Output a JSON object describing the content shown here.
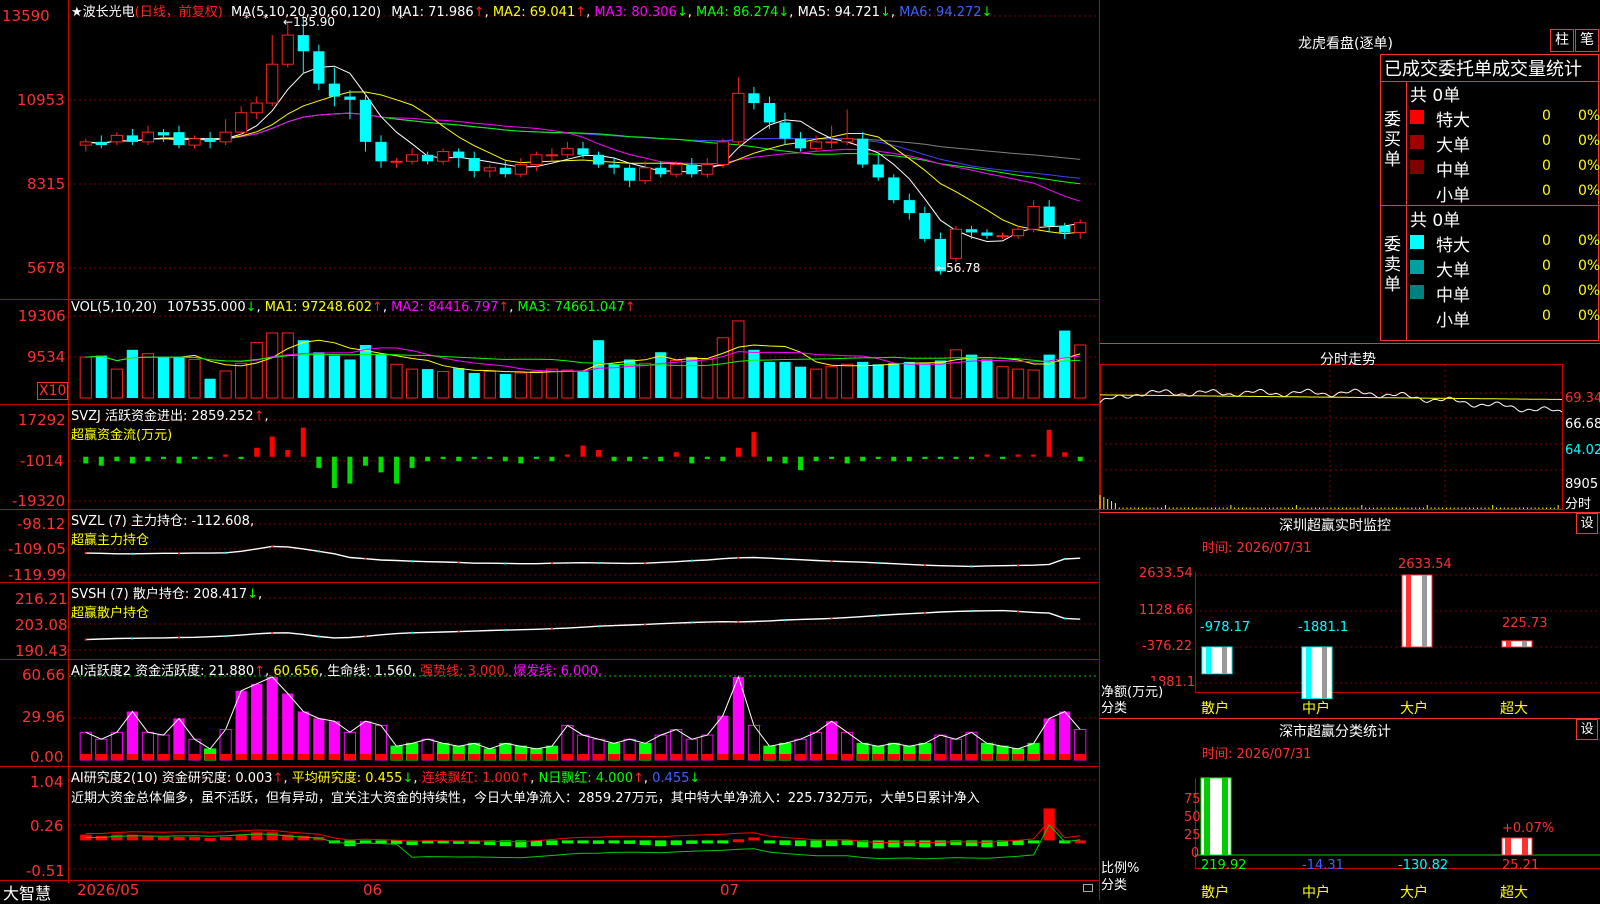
{
  "colors": {
    "up": "#ff2020",
    "down": "#00ffff",
    "red": "#ff0000",
    "ma1": "#ffffff",
    "ma2": "#ffff00",
    "ma3": "#ff00ff",
    "ma4": "#00ff00",
    "ma5": "#4040ff",
    "ma6": "#808080",
    "bg": "#000000",
    "grid": "#800000",
    "border": "#ff0000",
    "magenta": "#ff00ff",
    "green": "#00ff00",
    "cyan": "#00ffff",
    "yellow": "#ffff00"
  },
  "header": {
    "stock_name": "★波长光电",
    "period": "(日线，前复权)",
    "ma_label": "MA(5,10,20,30,60,120)",
    "ma1": "MA1: 71.986",
    "ma2": "MA2: 69.041",
    "ma3": "MA3: 80.306",
    "ma4": "MA4: 86.274",
    "ma5": "MA5: 94.721",
    "ma6": "MA6: 94.272",
    "arrow_up": "↑",
    "arrow_down": "↓"
  },
  "price_axis": {
    "ticks": [
      "13590",
      "10953",
      "8315",
      "5678"
    ],
    "high_label": "135.90",
    "low_label": "56.78"
  },
  "vol": {
    "label": "VOL(5,10,20)",
    "value": "107535.000",
    "arrow": "↓",
    "ma1": "MA1: 97248.602",
    "ma2": "MA2: 84416.797",
    "ma3": "MA3: 74661.047",
    "ticks": [
      "19306",
      "9534"
    ],
    "unit": "X10"
  },
  "svzj": {
    "label": "SVZJ  活跃资金进出: 2859.252",
    "subtitle": "超赢资金流(万元)",
    "ticks": [
      "17292",
      "-1014",
      "-19320"
    ]
  },
  "svzl": {
    "label": "SVZL (7) 主力持仓: -112.608",
    "subtitle": "超赢主力持仓",
    "ticks": [
      "-98.12",
      "-109.05",
      "-119.99"
    ]
  },
  "svsh": {
    "label": "SVSH (7) 散户持仓: 208.417",
    "subtitle": "超赢散户持仓",
    "ticks": [
      "216.21",
      "203.08",
      "190.43"
    ]
  },
  "ai_active": {
    "label": "AI活跃度2 资金活跃度: 21.880",
    "v2": "60.656",
    "life": "生命线: 1.560,",
    "strong": "强势线: 3.000,",
    "burst": "爆发线: 6.000,",
    "ticks": [
      "60.66",
      "29.96",
      "0.00"
    ]
  },
  "ai_research": {
    "label": "AI研究度2(10) 资金研究度: 0.003",
    "avg": "平均研究度: 0.455",
    "red_days": "连续飘红: 1.000",
    "n_red": "N日飘红: 4.000",
    "last": "0.455",
    "ticks": [
      "1.04",
      "0.26",
      "-0.51"
    ],
    "comment": "近期大资金总体偏多，虽不活跃，但有异动，宜关注大资金的持续性，今日大单净流入：2859.27万元，其中特大单净流入：225.732万元，大单5日累计净入"
  },
  "bottom_axis": {
    "logo": "大智慧",
    "dates": [
      "2026/05",
      "06",
      "07"
    ]
  },
  "lhb": {
    "title": "龙虎看盘(逐单)",
    "btn_bar": "柱",
    "btn_pen": "笔",
    "subtitle": "已成交委托单成交量统计",
    "buy_label": "委买单",
    "sell_label": "委卖单",
    "buy_total": "共 0单",
    "sell_total": "共 0单",
    "buy_rows": [
      {
        "name": "特大",
        "count": "0",
        "pct": "0%"
      },
      {
        "name": "大单",
        "count": "0",
        "pct": "0%"
      },
      {
        "name": "中单",
        "count": "0",
        "pct": "0%"
      },
      {
        "name": "小单",
        "count": "0",
        "pct": "0%"
      }
    ],
    "sell_rows": [
      {
        "name": "特大",
        "count": "0",
        "pct": "0%"
      },
      {
        "name": "大单",
        "count": "0",
        "pct": "0%"
      },
      {
        "name": "中单",
        "count": "0",
        "pct": "0%"
      },
      {
        "name": "小单",
        "count": "0",
        "pct": "0%"
      }
    ]
  },
  "intraday": {
    "title": "分时走势",
    "ticks": [
      "69.34",
      "66.68",
      "64.02"
    ],
    "vol_tick": "8905",
    "unit": "分时"
  },
  "sz_monitor": {
    "title": "深圳超赢实时监控",
    "btn": "设",
    "time": "时间: 2026/07/31",
    "ticks": [
      "2633.54",
      "1128.66",
      "-376.22",
      "-1881.1"
    ],
    "bars": [
      {
        "label": "散户",
        "value": -978.17,
        "text": "-978.17"
      },
      {
        "label": "中户",
        "value": -1881.1,
        "text": "-1881.1"
      },
      {
        "label": "大户",
        "value": 2633.54,
        "text": "2633.54"
      },
      {
        "label": "超大",
        "value": 225.73,
        "text": "225.73"
      }
    ],
    "ylabel": "净额(万元)",
    "xlabel": "分类"
  },
  "sz_classify": {
    "title": "深市超赢分类统计",
    "btn": "设",
    "time": "时间: 2026/07/31",
    "ticks": [
      "75",
      "50",
      "25",
      "0"
    ],
    "bars": [
      {
        "label": "散户",
        "text": "219.92"
      },
      {
        "label": "中户",
        "text": "-14.31"
      },
      {
        "label": "大户",
        "text": "-130.82"
      },
      {
        "label": "超大",
        "text": "25.21",
        "top_text": "+0.07%"
      }
    ],
    "ylabel": "比例%",
    "xlabel": "分类"
  },
  "chart_data": [
    {
      "type": "candlestick",
      "title": "波长光电 日线",
      "ylim": [
        56.78,
        135.9
      ],
      "candles": [
        [
          96,
          97,
          94,
          98
        ],
        [
          97,
          96,
          95,
          99
        ],
        [
          97,
          99,
          96,
          100
        ],
        [
          99,
          97,
          96,
          101
        ],
        [
          97,
          100,
          96,
          102
        ],
        [
          100,
          99,
          97,
          101
        ],
        [
          100,
          96,
          95,
          102
        ],
        [
          96,
          98,
          95,
          99
        ],
        [
          98,
          97,
          95,
          100
        ],
        [
          97,
          100,
          96,
          104
        ],
        [
          100,
          106,
          99,
          108
        ],
        [
          106,
          109,
          104,
          111
        ],
        [
          109,
          121,
          108,
          130
        ],
        [
          121,
          130,
          120,
          134
        ],
        [
          130,
          125,
          118,
          136
        ],
        [
          125,
          115,
          113,
          127
        ],
        [
          115,
          111,
          108,
          120
        ],
        [
          111,
          110,
          104,
          113
        ],
        [
          110,
          97,
          94,
          112
        ],
        [
          97,
          91,
          89,
          99
        ],
        [
          91,
          91,
          89,
          92
        ],
        [
          91,
          93,
          90,
          95
        ],
        [
          93,
          91,
          90,
          94
        ],
        [
          91,
          94,
          90,
          95
        ],
        [
          94,
          92,
          89,
          95
        ],
        [
          92,
          88,
          86,
          94
        ],
        [
          88,
          89,
          86,
          90
        ],
        [
          89,
          87,
          86,
          91
        ],
        [
          87,
          90,
          86,
          92
        ],
        [
          90,
          93,
          88,
          94
        ],
        [
          93,
          93,
          91,
          95
        ],
        [
          93,
          95,
          92,
          97
        ],
        [
          95,
          93,
          92,
          97
        ],
        [
          93,
          90,
          89,
          94
        ],
        [
          90,
          89,
          87,
          92
        ],
        [
          89,
          85,
          83,
          90
        ],
        [
          85,
          89,
          84,
          91
        ],
        [
          89,
          87,
          86,
          91
        ],
        [
          87,
          90,
          86,
          91
        ],
        [
          90,
          87,
          86,
          92
        ],
        [
          87,
          90,
          86,
          92
        ],
        [
          90,
          97,
          89,
          98
        ],
        [
          97,
          112,
          96,
          117
        ],
        [
          112,
          109,
          107,
          114
        ],
        [
          109,
          103,
          101,
          111
        ],
        [
          103,
          98,
          96,
          106
        ],
        [
          98,
          95,
          94,
          100
        ],
        [
          95,
          97,
          94,
          99
        ],
        [
          97,
          97,
          95,
          102
        ],
        [
          97,
          98,
          96,
          107
        ],
        [
          98,
          90,
          89,
          100
        ],
        [
          90,
          86,
          85,
          93
        ],
        [
          86,
          79,
          78,
          87
        ],
        [
          79,
          75,
          73,
          81
        ],
        [
          75,
          67,
          66,
          77
        ],
        [
          67,
          57,
          56,
          69
        ],
        [
          61,
          70,
          60,
          71
        ],
        [
          70,
          69,
          67,
          71
        ],
        [
          69,
          68,
          67,
          70
        ],
        [
          68,
          68,
          67,
          69
        ],
        [
          68,
          70,
          67,
          71
        ],
        [
          70,
          77,
          69,
          79
        ],
        [
          77,
          71,
          69,
          79
        ],
        [
          71,
          69,
          67,
          72
        ],
        [
          69,
          72,
          67,
          73
        ]
      ]
    },
    {
      "type": "bar",
      "title": "VOL",
      "values": [
        85,
        88,
        60,
        100,
        92,
        85,
        85,
        80,
        40,
        56,
        72,
        115,
        135,
        135,
        120,
        95,
        88,
        80,
        110,
        90,
        70,
        60,
        60,
        55,
        62,
        52,
        55,
        50,
        52,
        55,
        60,
        58,
        55,
        120,
        70,
        80,
        72,
        95,
        78,
        85,
        80,
        125,
        160,
        100,
        75,
        75,
        65,
        60,
        65,
        70,
        75,
        70,
        72,
        75,
        72,
        78,
        100,
        90,
        80,
        65,
        60,
        58,
        90,
        140,
        110,
        90
      ],
      "ylim": [
        0,
        193.06
      ]
    },
    {
      "type": "bar",
      "title": "SVZJ",
      "values": [
        -3,
        -4,
        -2,
        -3,
        -2,
        -1,
        -3,
        -1,
        -1,
        1,
        -1,
        4,
        9,
        3,
        13,
        -5,
        -14,
        -12,
        -4,
        -7,
        -12,
        -5,
        -2,
        -1,
        -2,
        -1,
        -1,
        -2,
        -3,
        -1,
        -2,
        1,
        5,
        3,
        -2,
        -2,
        -1,
        -2,
        2,
        -3,
        -1,
        -2,
        4,
        11,
        -2,
        -3,
        -6,
        -2,
        -1,
        -3,
        -2,
        -1,
        -2,
        -2,
        -1,
        -1,
        -1,
        -1,
        1,
        -1,
        1,
        1,
        12,
        2,
        -2,
        2
      ],
      "ylim": [
        -19.32,
        17.292
      ]
    },
    {
      "type": "line",
      "title": "SVZL",
      "values": [
        -110.7,
        -110.8,
        -111,
        -111,
        -110.9,
        -110.8,
        -110.8,
        -110.7,
        -110.7,
        -110.6,
        -110,
        -109,
        -108,
        -108.2,
        -109,
        -110,
        -111,
        -112.5,
        -113,
        -113.5,
        -113.7,
        -114,
        -114.2,
        -114.3,
        -114.5,
        -114.8,
        -114.8,
        -114.9,
        -115,
        -115,
        -114.8,
        -114.7,
        -114.6,
        -114.7,
        -114.8,
        -114.9,
        -114.8,
        -114.5,
        -114.2,
        -113.8,
        -113.5,
        -113,
        -112.6,
        -112.5,
        -112.8,
        -113.1,
        -113.4,
        -113.7,
        -114,
        -114.2,
        -114.4,
        -114.7,
        -115,
        -115.3,
        -115.6,
        -115.8,
        -116,
        -116.1,
        -115.9,
        -115.8,
        -115.7,
        -115.6,
        -115.3,
        -113.1,
        -112.8,
        -112.6
      ],
      "ylim": [
        -119.99,
        -98.12
      ]
    },
    {
      "type": "line",
      "title": "SVSH",
      "values": [
        195.5,
        195.8,
        196,
        196.1,
        196.2,
        196.3,
        196.5,
        196.6,
        196.9,
        197.2,
        197.7,
        198.3,
        198.7,
        198.8,
        198,
        197,
        196.3,
        196.5,
        197.1,
        197.8,
        198.4,
        198.8,
        199,
        199.2,
        199.4,
        199.6,
        199.9,
        200.1,
        200.3,
        200.5,
        200.8,
        201.1,
        201.5,
        202,
        202.3,
        202.6,
        202.9,
        203.2,
        203.5,
        203.8,
        204,
        204.2,
        204.1,
        204.3,
        204.6,
        205,
        205.3,
        205.5,
        205.8,
        206.2,
        206.7,
        207.2,
        207.7,
        208.1,
        208.5,
        208.9,
        209.2,
        209.4,
        209.5,
        209.6,
        209.2,
        208.7,
        208.4,
        205.8,
        205.4,
        205.1
      ],
      "ylim": [
        190.43,
        216.21
      ]
    },
    {
      "type": "bar",
      "title": "AI活跃度2",
      "values": [
        20,
        15,
        20,
        35,
        20,
        18,
        30,
        15,
        8,
        22,
        50,
        55,
        60,
        48,
        35,
        30,
        28,
        20,
        28,
        25,
        10,
        12,
        15,
        12,
        10,
        12,
        8,
        12,
        10,
        8,
        10,
        25,
        18,
        15,
        12,
        15,
        12,
        18,
        22,
        15,
        18,
        32,
        60,
        25,
        10,
        12,
        15,
        20,
        28,
        20,
        12,
        10,
        12,
        10,
        12,
        18,
        15,
        20,
        12,
        10,
        8,
        12,
        30,
        35,
        22,
        22
      ],
      "ylim": [
        0,
        60.66
      ]
    },
    {
      "type": "bar",
      "title": "AI研究度2",
      "values": [
        0.1,
        0.08,
        0.1,
        0.1,
        0.08,
        0.06,
        0.06,
        0.06,
        0.04,
        0.06,
        0.1,
        0.14,
        0.14,
        0.1,
        0.08,
        0.06,
        -0.05,
        -0.1,
        -0.05,
        -0.05,
        -0.06,
        -0.08,
        -0.05,
        -0.05,
        -0.06,
        -0.06,
        -0.08,
        -0.1,
        -0.12,
        -0.1,
        -0.08,
        -0.05,
        -0.04,
        -0.06,
        -0.05,
        -0.06,
        -0.08,
        -0.1,
        -0.08,
        -0.06,
        -0.04,
        -0.02,
        0.02,
        0.05,
        -0.05,
        -0.08,
        -0.1,
        -0.12,
        -0.1,
        -0.08,
        -0.12,
        -0.14,
        -0.12,
        -0.1,
        -0.12,
        -0.1,
        -0.08,
        -0.1,
        -0.12,
        -0.1,
        -0.08,
        -0.05,
        0.55,
        -0.05,
        0.0,
        -0.04
      ],
      "ylim": [
        -0.51,
        1.04
      ]
    }
  ]
}
